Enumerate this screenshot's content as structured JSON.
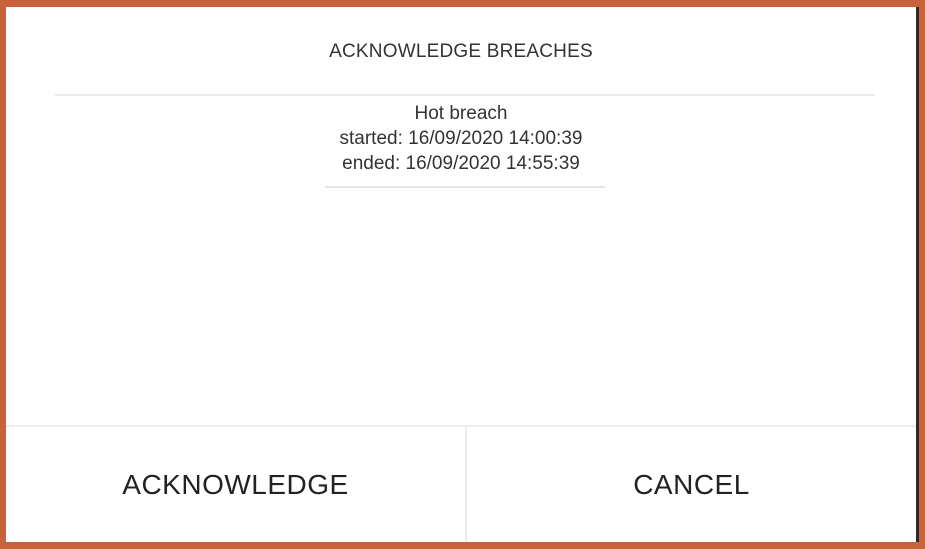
{
  "dialog": {
    "title": "ACKNOWLEDGE BREACHES",
    "breaches": [
      {
        "name": "Hot breach",
        "started": "started: 16/09/2020 14:00:39",
        "ended": "ended: 16/09/2020 14:55:39"
      }
    ],
    "buttons": {
      "acknowledge": "ACKNOWLEDGE",
      "cancel": "CANCEL"
    }
  },
  "colors": {
    "frame_border": "#c8623a",
    "text": "#333333",
    "divider": "#ececec"
  }
}
